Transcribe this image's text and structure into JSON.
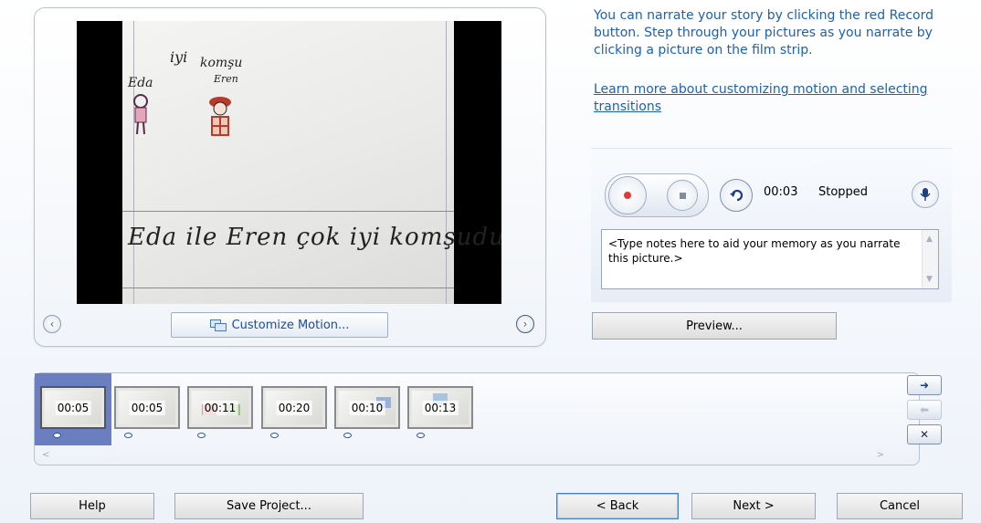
{
  "preview": {
    "customize_motion_label": "Customize Motion...",
    "photo_text": {
      "top_words_1": "iyi",
      "top_words_2": "komşu",
      "name_1": "Eda",
      "name_2": "Eren",
      "sentence": "Eda ile Eren çok iyi komşudur"
    }
  },
  "instructions": {
    "text": "You can narrate your story by clicking the red Record button. Step through your pictures as you narrate by clicking a picture on the film strip.",
    "link": "Learn more about customizing motion and selecting transitions"
  },
  "narration": {
    "time": "00:03",
    "status": "Stopped",
    "notes_placeholder": "<Type notes here to aid your memory as you narrate this picture.>",
    "preview_label": "Preview..."
  },
  "filmstrip": {
    "items": [
      {
        "duration": "00:05"
      },
      {
        "duration": "00:05"
      },
      {
        "duration": "00:11"
      },
      {
        "duration": "00:20"
      },
      {
        "duration": "00:10"
      },
      {
        "duration": "00:13"
      }
    ]
  },
  "buttons": {
    "help": "Help",
    "save_project": "Save Project...",
    "back": "< Back",
    "next": "Next >",
    "cancel": "Cancel"
  },
  "colors": {
    "link": "#1c61b5",
    "record_red": "#e03a3a",
    "film_selected": "#6b7fc0"
  }
}
